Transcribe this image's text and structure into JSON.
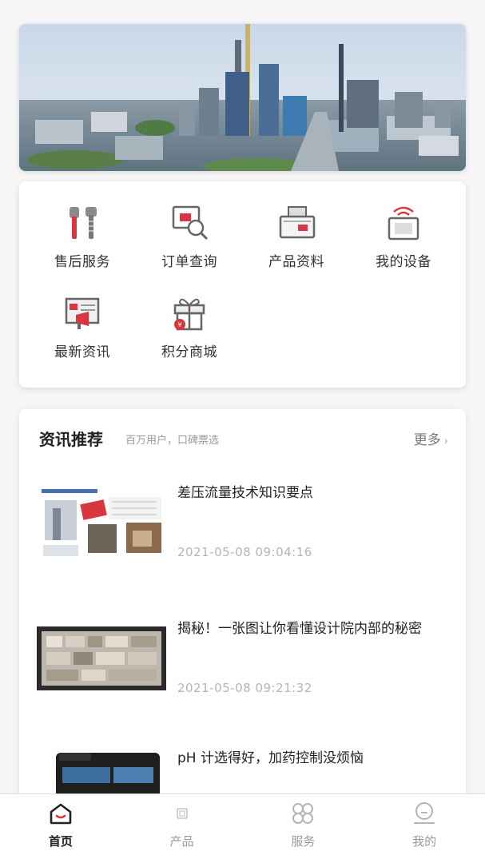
{
  "menu": {
    "items": [
      {
        "label": "售后服务",
        "icon": "tools-icon"
      },
      {
        "label": "订单查询",
        "icon": "order-search-icon"
      },
      {
        "label": "产品资料",
        "icon": "product-docs-icon"
      },
      {
        "label": "我的设备",
        "icon": "device-icon"
      },
      {
        "label": "最新资讯",
        "icon": "news-icon"
      },
      {
        "label": "积分商城",
        "icon": "gift-icon"
      }
    ]
  },
  "news": {
    "title": "资讯推荐",
    "subtitle": "百万用户，口碑票选",
    "more_label": "更多",
    "items": [
      {
        "headline": "差压流量技术知识要点",
        "date": "2021-05-08 09:04:16"
      },
      {
        "headline": "揭秘！一张图让你看懂设计院内部的秘密",
        "date": "2021-05-08 09:21:32"
      },
      {
        "headline": "pH 计选得好，加药控制没烦恼",
        "date": ""
      }
    ]
  },
  "tabbar": {
    "tabs": [
      {
        "label": "首页",
        "active": true
      },
      {
        "label": "产品",
        "active": false
      },
      {
        "label": "服务",
        "active": false
      },
      {
        "label": "我的",
        "active": false
      }
    ]
  },
  "colors": {
    "accent": "#d9363e",
    "text": "#222222",
    "muted": "#999999"
  }
}
